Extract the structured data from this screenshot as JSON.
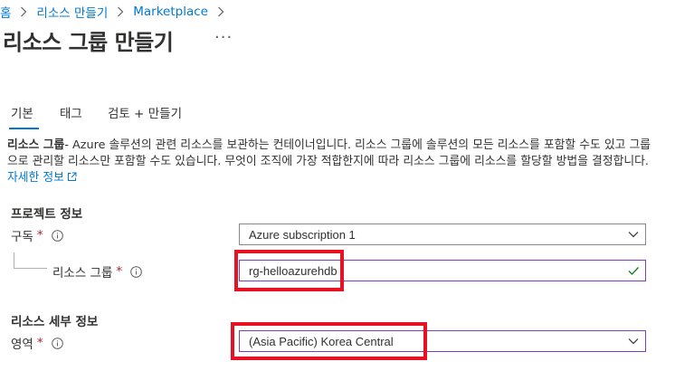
{
  "breadcrumb": {
    "items": [
      "홈",
      "리소스 만들기",
      "Marketplace"
    ]
  },
  "page": {
    "title": "리소스 그룹 만들기",
    "more": "···"
  },
  "tabs": [
    {
      "label": "기본"
    },
    {
      "label": "태그"
    },
    {
      "label": "검토 + 만들기"
    }
  ],
  "description": {
    "bold": "리소스 그룹",
    "text": "- Azure 솔루션의 관련 리소스를 보관하는 컨테이너입니다. 리소스 그룹에 솔루션의 모든 리소스를 포함할 수도 있고 그룹으로 관리할 리소스만 포함할 수도 있습니다. 무엇이 조직에 가장 적합한지에 따라 리소스 그룹에 리소스를 할당할 방법을 결정합니다. ",
    "link": "자세한 정보"
  },
  "project": {
    "heading": "프로젝트 정보",
    "subscription_label": "구독",
    "subscription_value": "Azure subscription 1",
    "resource_group_label": "리소스 그룹",
    "resource_group_value": "rg-helloazurehdb"
  },
  "details": {
    "heading": "리소스 세부 정보",
    "region_label": "영역",
    "region_value": "(Asia Pacific) Korea Central"
  },
  "colors": {
    "accent": "#0078d4",
    "required": "#a4262c",
    "valid": "#107c10",
    "highlight": "#e81123"
  },
  "icons": [
    "chevron-right-icon",
    "ellipsis-icon",
    "info-icon",
    "external-link-icon",
    "chevron-down-icon",
    "checkmark-icon"
  ]
}
